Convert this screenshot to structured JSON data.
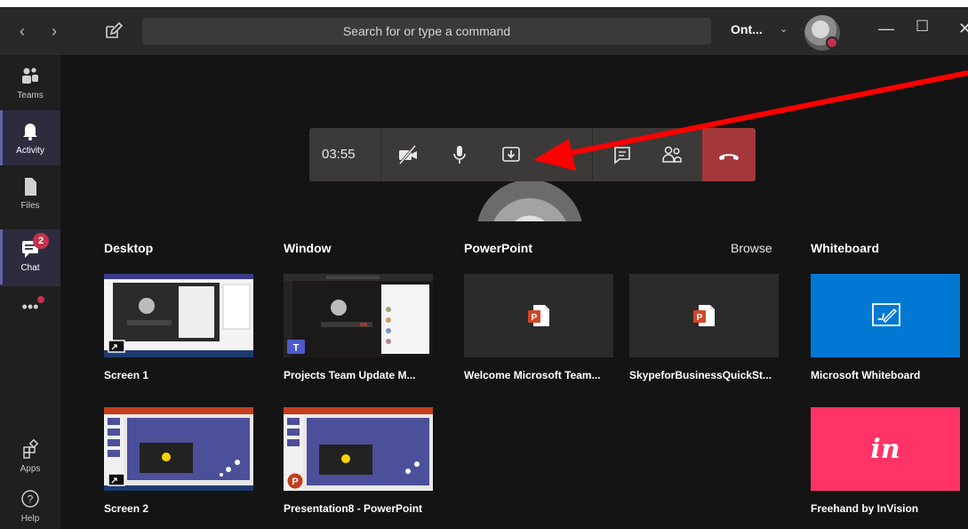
{
  "titlebar": {
    "search_placeholder": "Search for or type a command",
    "org_label": "Ont...",
    "nav_back": "‹",
    "nav_forward": "›"
  },
  "rail": {
    "items": [
      {
        "label": "Teams",
        "icon": "teams-icon"
      },
      {
        "label": "Activity",
        "icon": "bell-icon"
      },
      {
        "label": "Files",
        "icon": "file-icon"
      },
      {
        "label": "Chat",
        "icon": "chat-icon",
        "badge": "2"
      },
      {
        "label": "",
        "icon": "more-icon"
      },
      {
        "label": "Apps",
        "icon": "apps-icon"
      },
      {
        "label": "Help",
        "icon": "help-icon"
      }
    ]
  },
  "callbar": {
    "timer": "03:55"
  },
  "tray": {
    "sections": {
      "desktop": "Desktop",
      "window": "Window",
      "powerpoint": "PowerPoint",
      "browse": "Browse",
      "whiteboard": "Whiteboard"
    },
    "tiles": [
      {
        "caption": "Screen 1"
      },
      {
        "caption": "Projects Team Update M..."
      },
      {
        "caption": "Welcome Microsoft Team..."
      },
      {
        "caption": "SkypeforBusinessQuickSt..."
      },
      {
        "caption": "Microsoft Whiteboard"
      },
      {
        "caption": "Screen 2"
      },
      {
        "caption": "Presentation8 - PowerPoint"
      },
      {
        "caption": "Freehand by InVision",
        "logo_text": "in"
      }
    ]
  },
  "colors": {
    "accent": "#6264a7",
    "hangup": "#a4373a",
    "badge": "#c4314b",
    "whiteboard": "#0078d4",
    "invision": "#ff3366",
    "annotation_arrow": "#ff0000"
  }
}
